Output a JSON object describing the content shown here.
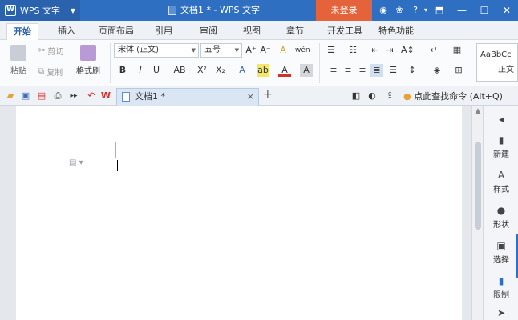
{
  "app": {
    "name": "WPS 文字",
    "doc_title": "文档1 * - WPS 文字",
    "login_label": "未登录"
  },
  "ribbon_tabs": [
    "开始",
    "插入",
    "页面布局",
    "引用",
    "审阅",
    "视图",
    "章节",
    "开发工具",
    "特色功能"
  ],
  "clipboard": {
    "paste": "粘贴",
    "cut": "剪切",
    "copy": "复制",
    "format_painter": "格式刷"
  },
  "font": {
    "name": "宋体 (正文)",
    "size": "五号"
  },
  "format_buttons": {
    "bold": "B",
    "italic": "I",
    "underline": "U",
    "strike": "AB",
    "superscript": "X²",
    "subscript": "X₂"
  },
  "styles": {
    "gallery_preview": "AaBbCc",
    "gallery_label": "正文"
  },
  "doc_tab": {
    "name": "文档1 *",
    "close": "×",
    "new": "+"
  },
  "find_command": "点此查找命令 (Alt+Q)",
  "sidebar": [
    "新建",
    "样式",
    "形状",
    "选择",
    "限制"
  ],
  "colors": {
    "titlebar": "#2f6fc2",
    "login": "#e5633a",
    "accent_tab": "#2a62ad"
  }
}
